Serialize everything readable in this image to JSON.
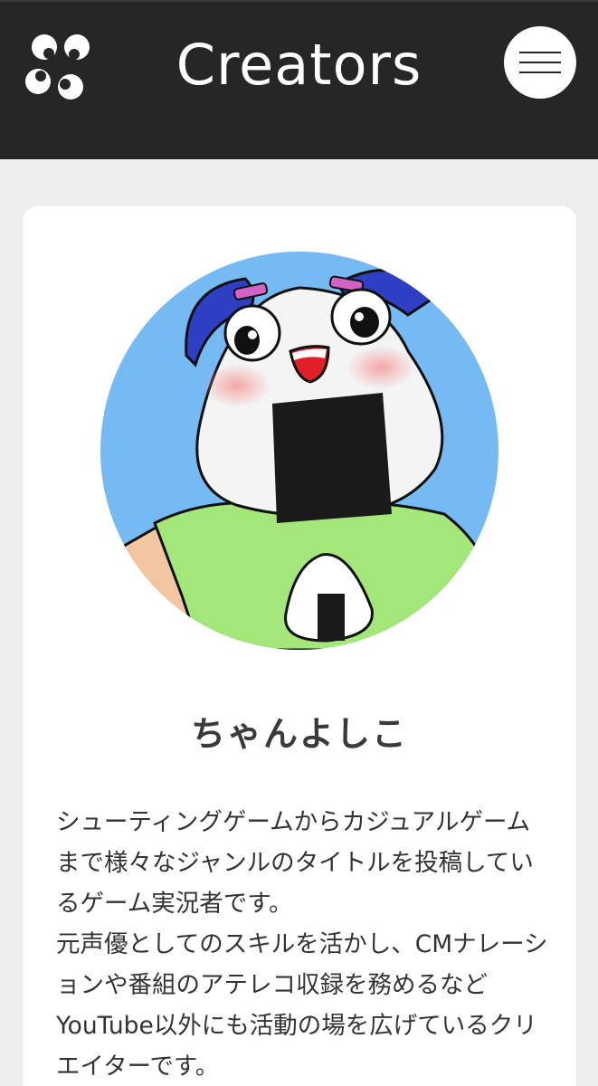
{
  "header": {
    "title": "Creators",
    "logo_icon": "four-circle-logo-icon",
    "menu_icon": "hamburger-menu-icon",
    "background": "#262626"
  },
  "creator": {
    "avatar_icon": "onigiri-character-avatar",
    "name": "ちゃんよしこ",
    "description": [
      "シューティングゲームからカジュアルゲームまで様々なジャンルのタイトルを投稿しているゲーム実況者です。",
      "元声優としてのスキルを活かし、CMナレーションや番組のアテレコ収録を務めるなどYouTube以外にも活動の場を広げているクリエイターです。"
    ]
  }
}
